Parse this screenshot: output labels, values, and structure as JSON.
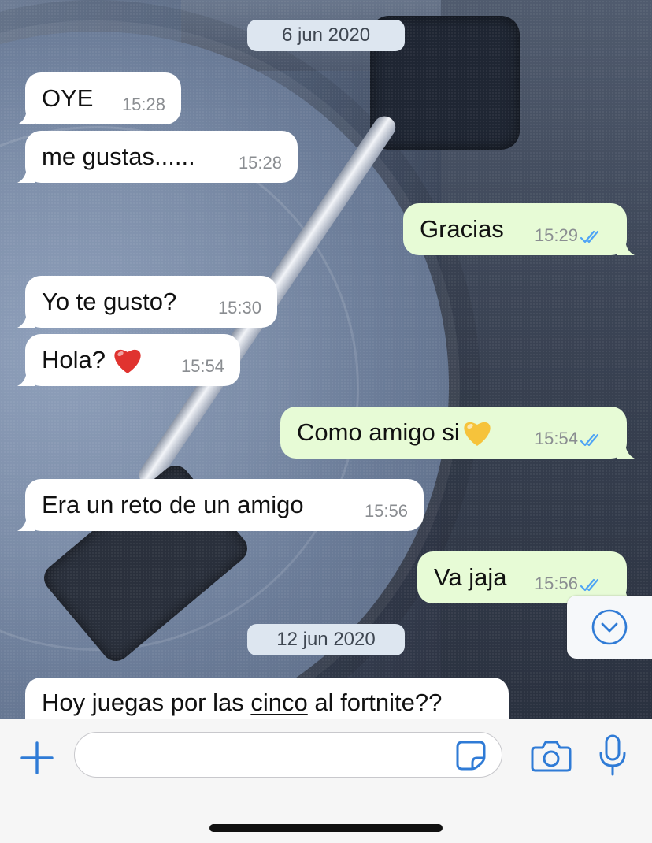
{
  "chat": {
    "dates": [
      "6 jun 2020",
      "12 jun 2020"
    ],
    "messages": [
      {
        "dir": "in",
        "text": "OYE",
        "time": "15:28"
      },
      {
        "dir": "in",
        "text": "me gustas......",
        "time": "15:28"
      },
      {
        "dir": "out",
        "text": "Gracias",
        "time": "15:29",
        "status": "read"
      },
      {
        "dir": "in",
        "text": "Yo te gusto?",
        "time": "15:30"
      },
      {
        "dir": "in",
        "text": "Hola? ",
        "time": "15:54",
        "emoji": "red-heart"
      },
      {
        "dir": "out",
        "text": "Como amigo si",
        "time": "15:54",
        "status": "read",
        "emoji": "yellow-heart"
      },
      {
        "dir": "in",
        "text": "Era un reto de un amigo",
        "time": "15:56"
      },
      {
        "dir": "out",
        "text": "Va jaja",
        "time": "15:56",
        "status": "read"
      },
      {
        "dir": "in",
        "text_before": "Hoy juegas por las ",
        "text_underlined": "cinco",
        "text_after": " al fortnite??"
      }
    ]
  },
  "composer": {
    "value": "",
    "icons": [
      "plus-icon",
      "sticker-icon",
      "camera-icon",
      "microphone-icon"
    ]
  },
  "scroll_button": {
    "icon": "chevron-down-circle-icon"
  },
  "colors": {
    "incoming_bubble": "#ffffff",
    "outgoing_bubble": "#e7fbd6",
    "accent": "#2f7bd6",
    "read_ticks": "#4fa4f5",
    "date_chip": "#dde6f0"
  }
}
